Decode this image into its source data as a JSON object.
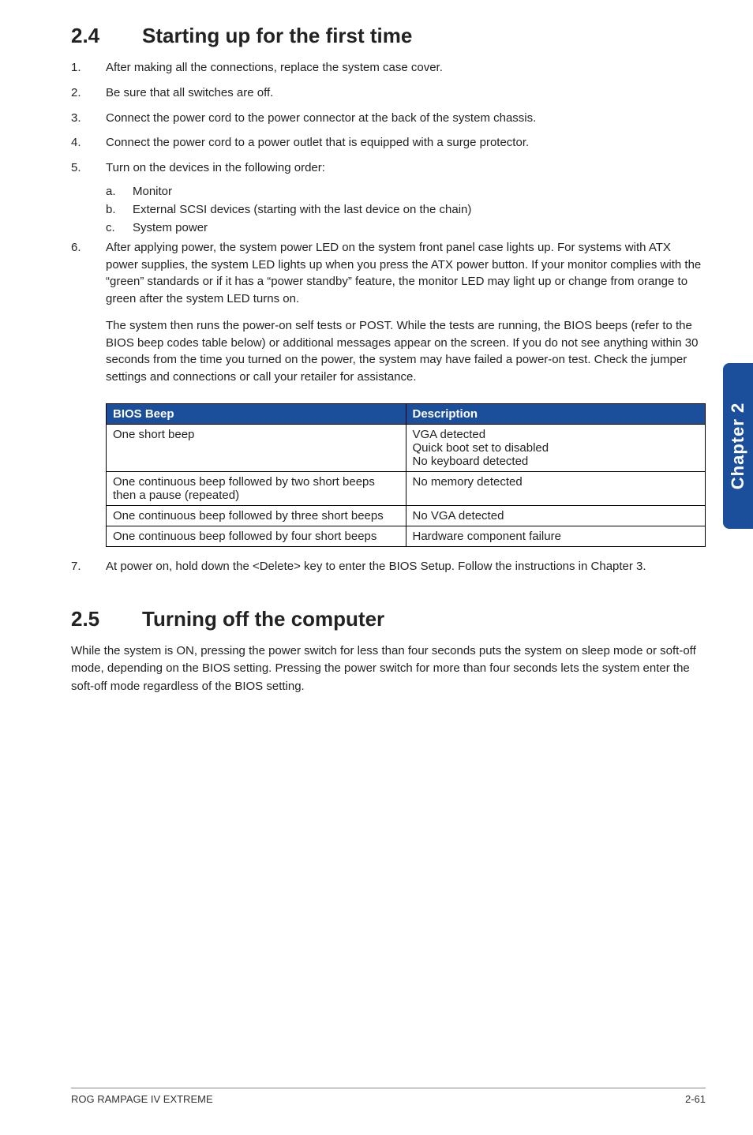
{
  "side_tab": "Chapter 2",
  "section24": {
    "num": "2.4",
    "title": "Starting up for the first time",
    "items": [
      {
        "n": "1.",
        "t": "After making all the connections, replace the system case cover."
      },
      {
        "n": "2.",
        "t": "Be sure that all switches are off."
      },
      {
        "n": "3.",
        "t": "Connect the power cord to the power connector at the back of the system chassis."
      },
      {
        "n": "4.",
        "t": "Connect the power cord to a power outlet that is equipped with a surge protector."
      },
      {
        "n": "5.",
        "t": "Turn on the devices in the following order:"
      }
    ],
    "sub5": [
      {
        "n": "a.",
        "t": "Monitor"
      },
      {
        "n": "b.",
        "t": "External SCSI devices (starting with the last device on the chain)"
      },
      {
        "n": "c.",
        "t": "System power"
      }
    ],
    "item6": {
      "n": "6.",
      "p1": "After applying power, the system power LED on the system front panel case lights up. For systems with ATX power supplies, the system LED lights up when you press the ATX power button. If your monitor complies with the “green” standards or if it has a “power standby” feature, the monitor LED may light up or change from orange to green after the system LED turns on.",
      "p2": "The system then runs the power-on self tests or POST. While the tests are running, the BIOS beeps (refer to the BIOS beep codes table below) or additional messages appear on the screen. If you do not see anything within 30 seconds from the time you turned on the power, the system may have failed a power-on test. Check the jumper settings and connections or call your retailer for assistance."
    },
    "table": {
      "h1": "BIOS Beep",
      "h2": "Description",
      "rows": [
        {
          "c1": "One short beep",
          "c2": "VGA detected\nQuick boot set to disabled\nNo keyboard detected"
        },
        {
          "c1": "One continuous beep followed by two short beeps then a pause (repeated)",
          "c2": "No memory detected"
        },
        {
          "c1": "One continuous beep followed by three short beeps",
          "c2": "No VGA detected"
        },
        {
          "c1": "One continuous beep followed by four short beeps",
          "c2": "Hardware component failure"
        }
      ]
    },
    "item7": {
      "n": "7.",
      "t": "At power on, hold down the <Delete> key to enter the BIOS Setup. Follow the instructions in Chapter 3."
    }
  },
  "section25": {
    "num": "2.5",
    "title": "Turning off the computer",
    "body": "While the system is ON, pressing the power switch for less than four seconds puts the system on sleep mode or soft-off mode, depending on the BIOS setting. Pressing the power switch for more than four seconds lets the system enter the soft-off mode regardless of the BIOS setting."
  },
  "footer": {
    "left": "ROG RAMPAGE IV EXTREME",
    "right": "2-61"
  }
}
